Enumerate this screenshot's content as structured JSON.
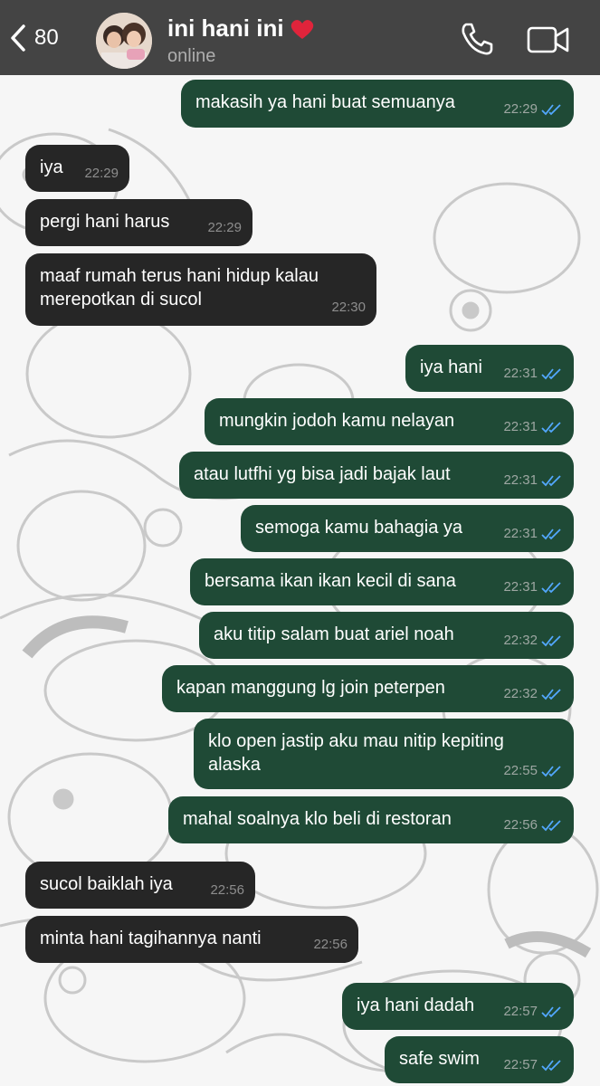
{
  "header": {
    "back_count": "80",
    "contact_name": "ini hani ini",
    "status": "online"
  },
  "colors": {
    "header_bg": "#444444",
    "incoming_bubble": "#262626",
    "outgoing_bubble": "#1f4a36",
    "read_ticks": "#53a8ff"
  },
  "icons": [
    "back-chevron-icon",
    "heart-icon",
    "phone-icon",
    "video-camera-icon",
    "read-ticks-icon"
  ],
  "messages": [
    {
      "dir": "out",
      "text": "makasih ya hani buat semuanya",
      "time": "22:29"
    },
    {
      "dir": "in",
      "text": "iya",
      "time": "22:29"
    },
    {
      "dir": "in",
      "text": "pergi hani harus",
      "time": "22:29"
    },
    {
      "dir": "in",
      "text": "maaf rumah terus hani hidup kalau merepotkan di sucol",
      "time": "22:30"
    },
    {
      "dir": "out",
      "text": "iya hani",
      "time": "22:31"
    },
    {
      "dir": "out",
      "text": "mungkin jodoh kamu nelayan",
      "time": "22:31"
    },
    {
      "dir": "out",
      "text": "atau lutfhi yg bisa jadi bajak laut",
      "time": "22:31"
    },
    {
      "dir": "out",
      "text": "semoga kamu bahagia ya",
      "time": "22:31"
    },
    {
      "dir": "out",
      "text": "bersama ikan ikan kecil di sana",
      "time": "22:31"
    },
    {
      "dir": "out",
      "text": "aku titip salam buat ariel noah",
      "time": "22:32"
    },
    {
      "dir": "out",
      "text": "kapan manggung lg join peterpen",
      "time": "22:32"
    },
    {
      "dir": "out",
      "text": "klo open jastip aku mau nitip kepiting alaska",
      "time": "22:55"
    },
    {
      "dir": "out",
      "text": "mahal soalnya klo beli di restoran",
      "time": "22:56"
    },
    {
      "dir": "in",
      "text": "sucol baiklah iya",
      "time": "22:56"
    },
    {
      "dir": "in",
      "text": "minta hani tagihannya nanti",
      "time": "22:56"
    },
    {
      "dir": "out",
      "text": "iya hani dadah",
      "time": "22:57"
    },
    {
      "dir": "out",
      "text": "safe swim",
      "time": "22:57"
    }
  ]
}
